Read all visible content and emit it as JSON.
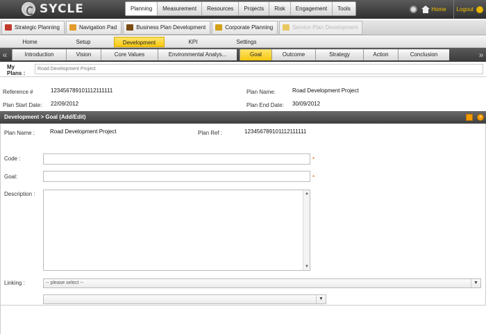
{
  "app": {
    "logo_text": "SYCLE"
  },
  "topnav": {
    "items": [
      "Planning",
      "Measurement",
      "Resources",
      "Projects",
      "Risk",
      "Engagement",
      "Tools"
    ],
    "active": "Planning"
  },
  "top_right": {
    "home_label": "Home",
    "logout_label": "Logout"
  },
  "modules": [
    {
      "label": "Strategic Planning",
      "color": "#c0392b"
    },
    {
      "label": "Navigation Pad",
      "color": "#e39b2c"
    },
    {
      "label": "Business Plan Development",
      "color": "#7b4a12"
    },
    {
      "label": "Corporate Planning",
      "color": "#d4a017"
    },
    {
      "label": "Service Plan Development",
      "color": "#e8c860",
      "disabled": true
    }
  ],
  "subnav": {
    "items": [
      "Home",
      "Setup",
      "Development",
      "KPI",
      "Settings"
    ],
    "active": "Development"
  },
  "steps": {
    "items": [
      "Introduction",
      "Vision",
      "Core Values",
      "Environmental Analys...",
      "Goal",
      "Outcome",
      "Strategy",
      "Action",
      "Conclusion"
    ],
    "active": "Goal",
    "prev_arrow": "«",
    "next_arrow": "»"
  },
  "myplans": {
    "label_line1": "My",
    "label_line2": "Plans :",
    "value": "Road Development Project"
  },
  "plan_info": {
    "reference_label": "Reference #",
    "reference_value": "123456789101112111111",
    "plan_name_label": "Plan Name:",
    "plan_name_value": "Road Development Project",
    "start_label": "Plan Start Date:",
    "start_value": "22/09/2012",
    "end_label": "Plan End Date:",
    "end_value": "30/09/2012"
  },
  "section": {
    "title": "Development > Goal (Add/Edit)"
  },
  "form": {
    "plan_name_label": "Plan Name :",
    "plan_name_value": "Road Development Project",
    "plan_ref_label": "Plan Ref :",
    "plan_ref_value": "123456789101112111111",
    "code_label": "Code :",
    "code_value": "",
    "goal_label": "Goal:",
    "goal_value": "",
    "description_label": "Description :",
    "description_value": "",
    "linking_label": "Linking :",
    "linking_selected": "-- please select --",
    "linking2_selected": "",
    "required_mark": "*"
  }
}
